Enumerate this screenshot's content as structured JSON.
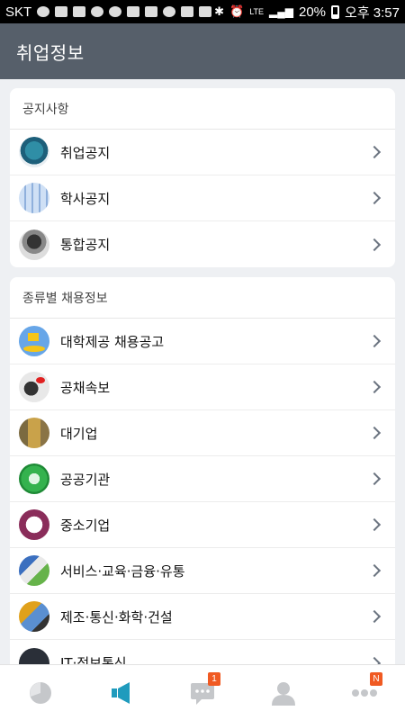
{
  "status_bar": {
    "carrier": "SKT",
    "network": "LTE",
    "battery_percent": "20%",
    "time": "오후 3:57"
  },
  "header": {
    "title": "취업정보"
  },
  "sections": [
    {
      "title": "공지사항",
      "items": [
        {
          "label": "취업공지",
          "icon": "notice-badge-icon"
        },
        {
          "label": "학사공지",
          "icon": "calendar-icon"
        },
        {
          "label": "통합공지",
          "icon": "person-photo-icon"
        }
      ]
    },
    {
      "title": "종류별 채용정보",
      "items": [
        {
          "label": "대학제공 채용공고",
          "icon": "flag-icon"
        },
        {
          "label": "공채속보",
          "icon": "speech-person-icon"
        },
        {
          "label": "대기업",
          "icon": "building-icon"
        },
        {
          "label": "공공기관",
          "icon": "public-emblem-icon"
        },
        {
          "label": "중소기업",
          "icon": "sme-logo-icon"
        },
        {
          "label": "서비스·교육·금융·유통",
          "icon": "service-collage-icon"
        },
        {
          "label": "제조·통신·화학·건설",
          "icon": "industry-collage-icon"
        },
        {
          "label": "IT·정보통신",
          "icon": "it-icon"
        }
      ]
    }
  ],
  "bottom_nav": {
    "items": [
      {
        "name": "home",
        "badge": ""
      },
      {
        "name": "notice",
        "badge": ""
      },
      {
        "name": "messages",
        "badge": "1"
      },
      {
        "name": "profile",
        "badge": ""
      },
      {
        "name": "more",
        "badge": "N"
      }
    ]
  },
  "colors": {
    "header_bg": "#565f6a",
    "active_nav": "#1f9bbd",
    "inactive_nav": "#c5c7ca",
    "badge": "#f05a22"
  }
}
